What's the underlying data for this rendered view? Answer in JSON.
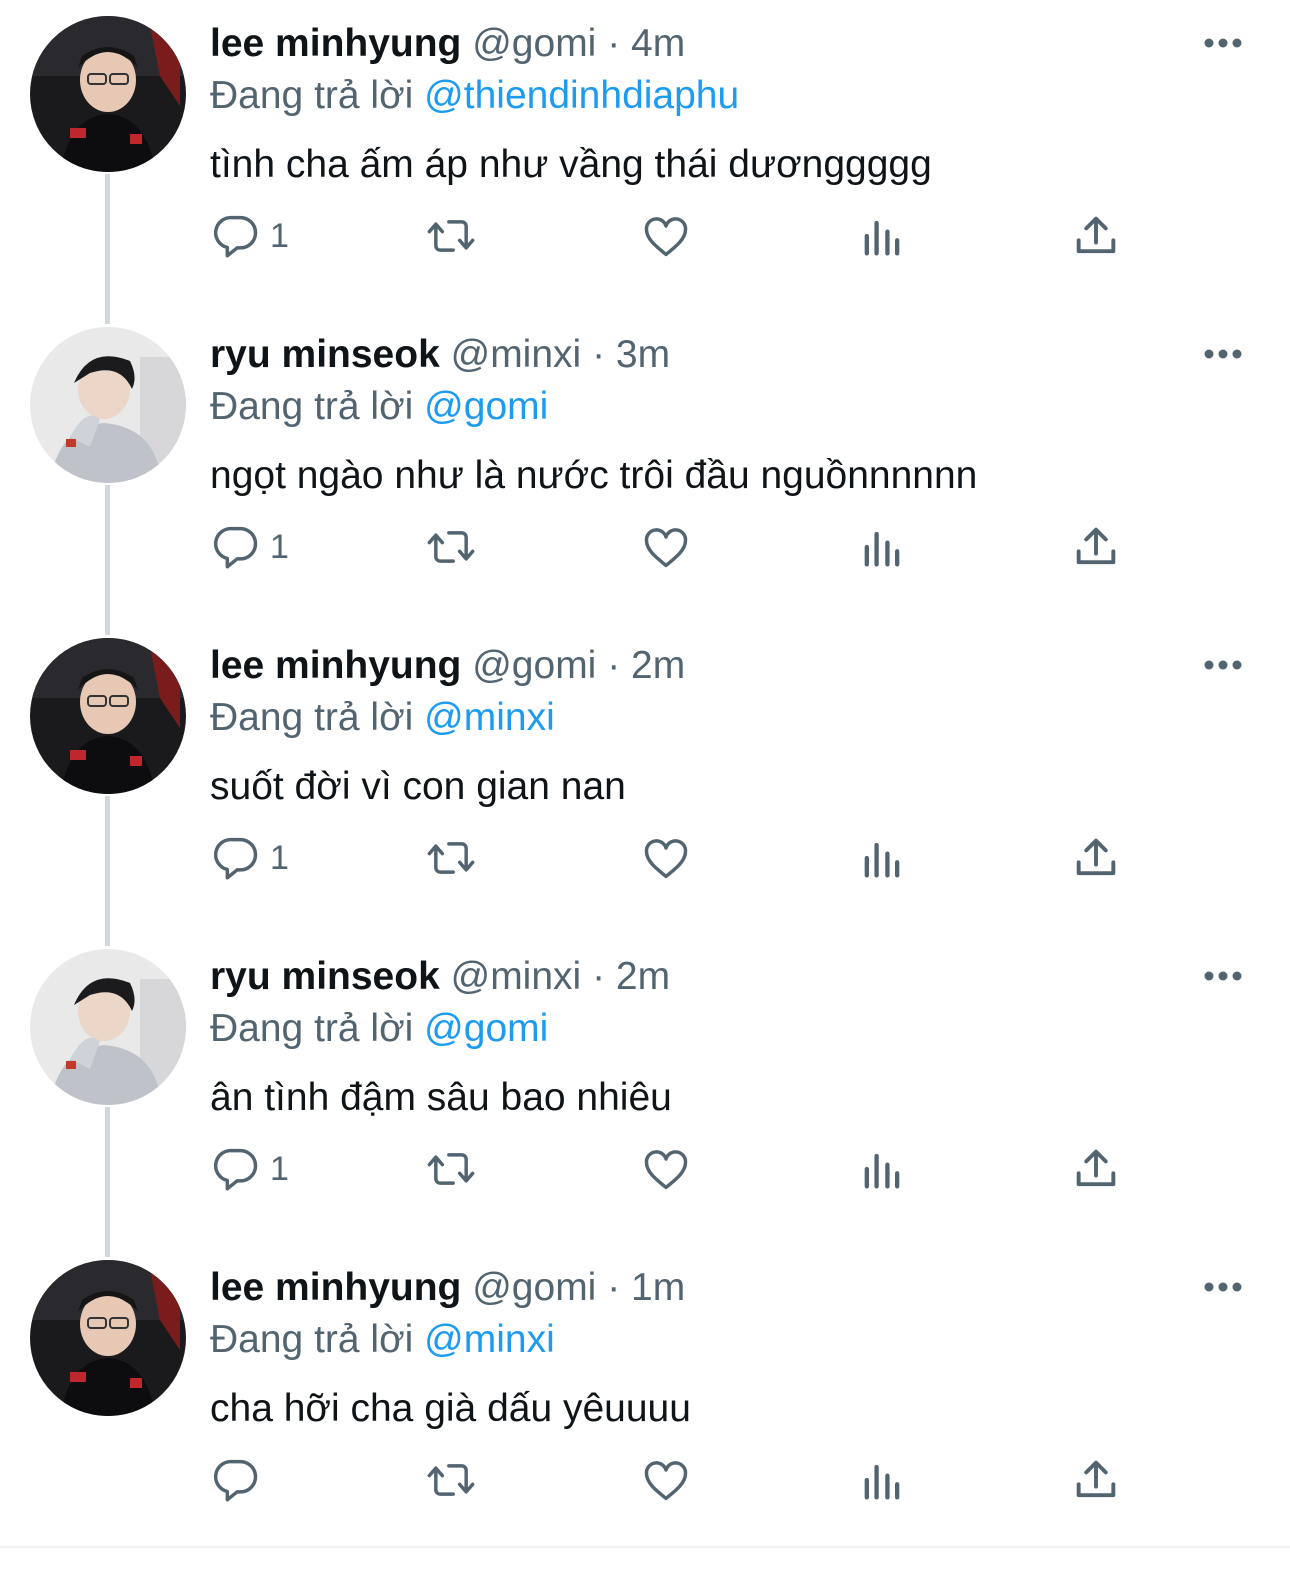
{
  "tweets": [
    {
      "name": "lee minhyung",
      "handle": "@gomi",
      "dot": "·",
      "time": "4m",
      "reply_prefix": "Đang trả lời",
      "reply_to": "@thiendinhdiaphu",
      "text": "tình cha ấm áp như vầng thái dươnggggg",
      "reply_count": "1"
    },
    {
      "name": "ryu minseok",
      "handle": "@minxi",
      "dot": "·",
      "time": "3m",
      "reply_prefix": "Đang trả lời",
      "reply_to": "@gomi",
      "text": "ngọt ngào như là nước trôi đầu nguồnnnnnn",
      "reply_count": "1"
    },
    {
      "name": "lee minhyung",
      "handle": "@gomi",
      "dot": "·",
      "time": "2m",
      "reply_prefix": "Đang trả lời",
      "reply_to": "@minxi",
      "text": "suốt đời vì con gian nan",
      "reply_count": "1"
    },
    {
      "name": "ryu minseok",
      "handle": "@minxi",
      "dot": "·",
      "time": "2m",
      "reply_prefix": "Đang trả lời",
      "reply_to": "@gomi",
      "text": "ân tình đậm sâu bao nhiêu",
      "reply_count": "1"
    },
    {
      "name": "lee minhyung",
      "handle": "@gomi",
      "dot": "·",
      "time": "1m",
      "reply_prefix": "Đang trả lời",
      "reply_to": "@minxi",
      "text": "cha hỡi cha già dấu yêuuuu",
      "reply_count": ""
    }
  ],
  "icons": {
    "reply": "reply-icon",
    "retweet": "retweet-icon",
    "like": "heart-icon",
    "views": "views-icon",
    "share": "share-icon",
    "more": "more-icon"
  },
  "colors": {
    "text": "#0f1419",
    "secondary": "#536471",
    "mention": "#1d9bf0",
    "thread_line": "#cfd9de"
  }
}
